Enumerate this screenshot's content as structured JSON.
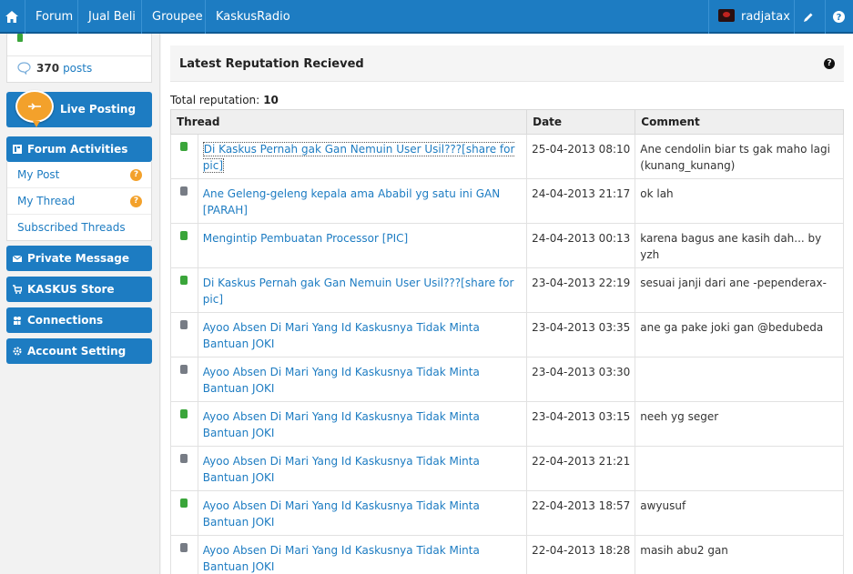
{
  "topnav": {
    "items": [
      {
        "label": "Forum"
      },
      {
        "label": "Jual Beli"
      },
      {
        "label": "Groupee"
      },
      {
        "label": "KaskusRadio"
      }
    ],
    "username": "radjatax"
  },
  "sidebar": {
    "posts_count": "370",
    "posts_label": "posts",
    "live_posting": "Live Posting",
    "forum_activities": "Forum Activities",
    "forum_items": [
      {
        "label": "My Post",
        "badge": "?"
      },
      {
        "label": "My Thread",
        "badge": "?"
      },
      {
        "label": "Subscribed Threads"
      }
    ],
    "private_message": "Private Message",
    "store": "KASKUS Store",
    "connections": "Connections",
    "account_setting": "Account Setting"
  },
  "main": {
    "title": "Latest Reputation Recieved",
    "total_label": "Total reputation:",
    "total_value": "10",
    "columns": [
      "Thread",
      "Date",
      "Comment"
    ],
    "colors": {
      "green": "#3aa53a",
      "gray": "#777c85"
    },
    "rows": [
      {
        "status": "green",
        "thread": "Di Kaskus Pernah gak Gan Nemuin User Usil???[share for pic]",
        "date": "25-04-2013 08:10",
        "comment": "Ane cendolin biar ts gak maho lagi (kunang_kunang)"
      },
      {
        "status": "gray",
        "thread": "Ane Geleng-geleng kepala ama Ababil yg satu ini GAN [PARAH]",
        "date": "24-04-2013 21:17",
        "comment": "ok lah"
      },
      {
        "status": "green",
        "thread": "Mengintip Pembuatan Processor [PIC]",
        "date": "24-04-2013 00:13",
        "comment": "karena bagus ane kasih dah... by yzh"
      },
      {
        "status": "green",
        "thread": "Di Kaskus Pernah gak Gan Nemuin User Usil???[share for pic]",
        "date": "23-04-2013 22:19",
        "comment": "sesuai janji dari ane -pependerax-"
      },
      {
        "status": "gray",
        "thread": "Ayoo Absen Di Mari Yang Id Kaskusnya Tidak Minta Bantuan JOKI",
        "date": "23-04-2013 03:35",
        "comment": "ane ga pake joki gan @bedubeda"
      },
      {
        "status": "gray",
        "thread": "Ayoo Absen Di Mari Yang Id Kaskusnya Tidak Minta Bantuan JOKI",
        "date": "23-04-2013 03:30",
        "comment": ""
      },
      {
        "status": "green",
        "thread": "Ayoo Absen Di Mari Yang Id Kaskusnya Tidak Minta Bantuan JOKI",
        "date": "23-04-2013 03:15",
        "comment": "neeh yg seger"
      },
      {
        "status": "gray",
        "thread": "Ayoo Absen Di Mari Yang Id Kaskusnya Tidak Minta Bantuan JOKI",
        "date": "22-04-2013 21:21",
        "comment": ""
      },
      {
        "status": "green",
        "thread": "Ayoo Absen Di Mari Yang Id Kaskusnya Tidak Minta Bantuan JOKI",
        "date": "22-04-2013 18:57",
        "comment": "awyusuf"
      },
      {
        "status": "gray",
        "thread": "Ayoo Absen Di Mari Yang Id Kaskusnya Tidak Minta Bantuan JOKI",
        "date": "22-04-2013 18:28",
        "comment": "masih abu2 gan"
      }
    ]
  }
}
